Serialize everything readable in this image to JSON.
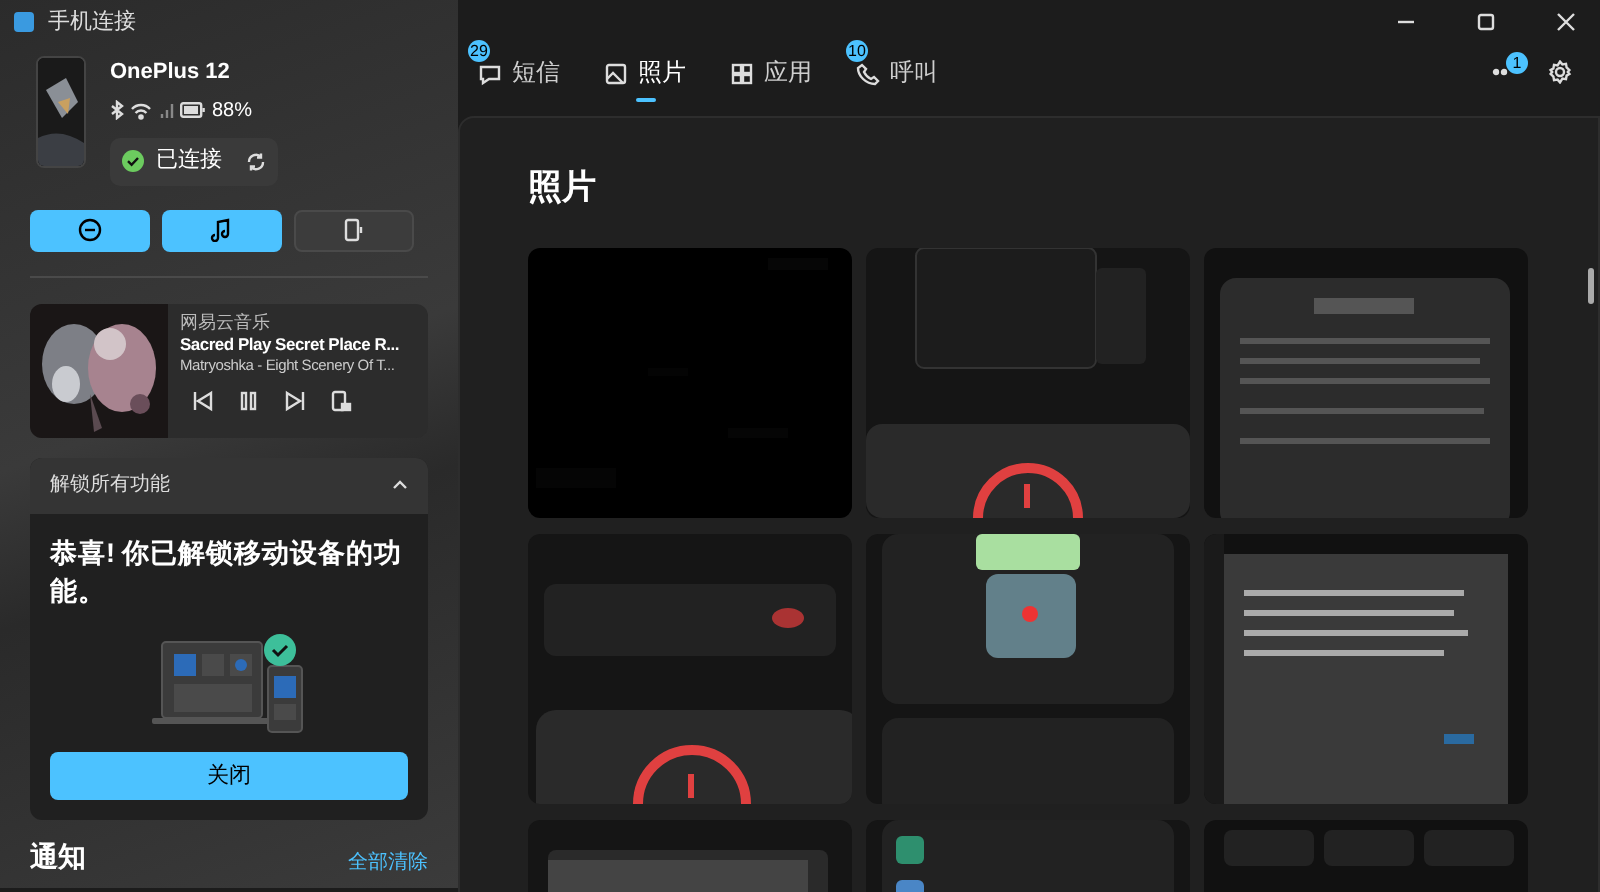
{
  "window": {
    "title": "手机连接"
  },
  "device": {
    "name": "OnePlus 12",
    "battery": "88%",
    "status": "已连接"
  },
  "quick_actions": [
    {
      "kind": "dnd",
      "on": true
    },
    {
      "kind": "audio",
      "on": true
    },
    {
      "kind": "cast",
      "on": false
    }
  ],
  "media": {
    "app": "网易云音乐",
    "title": "Sacred Play Secret Place R...",
    "artist": "Matryoshka - Eight Scenery Of T..."
  },
  "unlock_panel": {
    "header": "解锁所有功能",
    "expanded": true,
    "message": "恭喜! 你已解锁移动设备的功能。",
    "button": "关闭"
  },
  "notifications": {
    "title": "通知",
    "clear": "全部清除"
  },
  "tabs": [
    {
      "label": "短信",
      "badge": "29",
      "kind": "messages",
      "selected": false
    },
    {
      "label": "照片",
      "kind": "photos",
      "selected": true
    },
    {
      "label": "应用",
      "kind": "apps",
      "selected": false
    },
    {
      "label": "呼叫",
      "badge": "10",
      "kind": "calls",
      "selected": false
    }
  ],
  "more_badge": "1",
  "page_title": "照片"
}
